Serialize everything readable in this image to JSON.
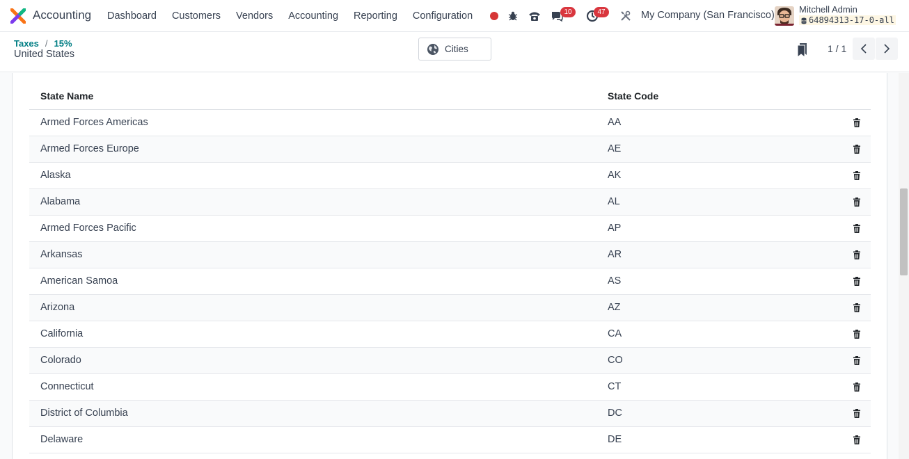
{
  "navbar": {
    "app_name": "Accounting",
    "menu": [
      "Dashboard",
      "Customers",
      "Vendors",
      "Accounting",
      "Reporting",
      "Configuration"
    ],
    "messages_count": "10",
    "activities_count": "47",
    "company": "My Company (San Francisco)",
    "user_name": "Mitchell Admin",
    "db_name": "64894313-17-0-all",
    "colors": {
      "accent": "#017e84",
      "badge": "#d9363e",
      "record": "#d63636"
    }
  },
  "control": {
    "breadcrumb": [
      "Taxes",
      "15%"
    ],
    "title": "United States",
    "cities_label": "Cities",
    "pager": "1 / 1"
  },
  "table": {
    "headers": [
      "State Name",
      "State Code"
    ],
    "rows": [
      [
        "Armed Forces Americas",
        "AA"
      ],
      [
        "Armed Forces Europe",
        "AE"
      ],
      [
        "Alaska",
        "AK"
      ],
      [
        "Alabama",
        "AL"
      ],
      [
        "Armed Forces Pacific",
        "AP"
      ],
      [
        "Arkansas",
        "AR"
      ],
      [
        "American Samoa",
        "AS"
      ],
      [
        "Arizona",
        "AZ"
      ],
      [
        "California",
        "CA"
      ],
      [
        "Colorado",
        "CO"
      ],
      [
        "Connecticut",
        "CT"
      ],
      [
        "District of Columbia",
        "DC"
      ],
      [
        "Delaware",
        "DE"
      ]
    ]
  }
}
